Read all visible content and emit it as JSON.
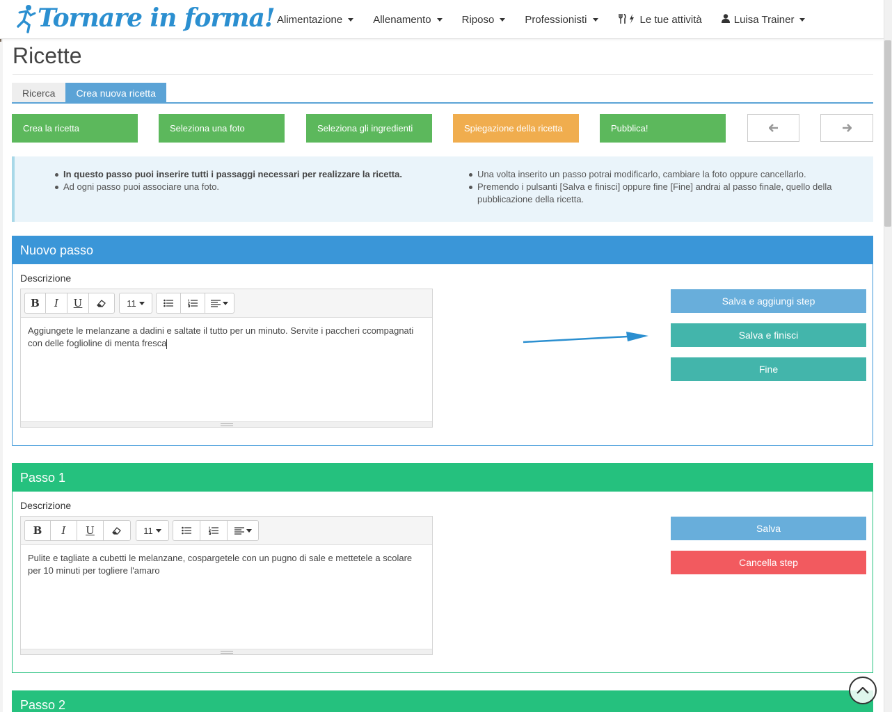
{
  "brand": {
    "name": "Tornare in forma!"
  },
  "nav": {
    "items": [
      {
        "label": "Alimentazione",
        "dropdown": true,
        "icon": ""
      },
      {
        "label": "Allenamento",
        "dropdown": true,
        "icon": ""
      },
      {
        "label": "Riposo",
        "dropdown": true,
        "icon": ""
      },
      {
        "label": "Professionisti",
        "dropdown": true,
        "icon": ""
      },
      {
        "label": "Le tue attività",
        "dropdown": false,
        "icon": "fork-knife-bolt-icon"
      },
      {
        "label": "Luisa Trainer",
        "dropdown": true,
        "icon": "user-icon"
      }
    ]
  },
  "page": {
    "title": "Ricette"
  },
  "tabs": [
    {
      "label": "Ricerca",
      "active": false
    },
    {
      "label": "Crea nuova ricetta",
      "active": true
    }
  ],
  "wizard": {
    "steps": [
      {
        "label": "Crea la ricetta",
        "state": "done"
      },
      {
        "label": "Seleziona una foto",
        "state": "done"
      },
      {
        "label": "Seleziona gli ingredienti",
        "state": "done"
      },
      {
        "label": "Spiegazione della ricetta",
        "state": "current"
      },
      {
        "label": "Pubblica!",
        "state": "done"
      }
    ],
    "prev_icon": "arrow-left-icon",
    "next_icon": "arrow-right-icon"
  },
  "info": {
    "left": [
      "In questo passo puoi inserire tutti i passaggi necessari per realizzare la ricetta.",
      "Ad ogni passo puoi associare una foto."
    ],
    "right": [
      "Una volta inserito un passo potrai modificarlo, cambiare la foto oppure cancellarlo.",
      "Premendo i pulsanti [Salva e finisci] oppure fine [Fine] andrai al passo finale, quello della pubblicazione della ricetta."
    ]
  },
  "editor_toolbar": {
    "bold": "B",
    "italic": "I",
    "underline": "U",
    "font_size": "11"
  },
  "new_step": {
    "title": "Nuovo passo",
    "label": "Descrizione",
    "text": "Aggiungete le melanzane a dadini e saltate il tutto per un minuto. Servite i paccheri ccompagnati con delle foglioline di menta fresca",
    "buttons": {
      "save_add": "Salva e aggiungi step",
      "save_finish": "Salva e finisci",
      "finish": "Fine"
    }
  },
  "step1": {
    "title": "Passo 1",
    "label": "Descrizione",
    "text": "Pulite e tagliate a cubetti le melanzane, cospargetele con un pugno di sale e mettetele a scolare per 10 minuti per togliere l'amaro",
    "buttons": {
      "save": "Salva",
      "delete": "Cancella step"
    }
  },
  "step2": {
    "title": "Passo 2"
  },
  "colors": {
    "primary": "#3a96d8",
    "success": "#5cb85c",
    "warning": "#f0ad4e",
    "step_panel": "#25c17e",
    "danger": "#f25a5f",
    "teal": "#43b5ab"
  }
}
